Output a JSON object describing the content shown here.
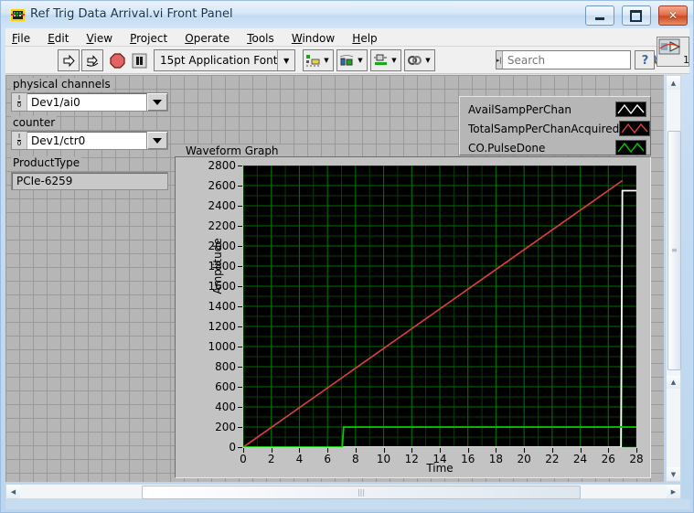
{
  "window": {
    "title": "Ref Trig Data Arrival.vi Front Panel",
    "icon_name": "labview-vi-icon",
    "minimize_label": "Minimize",
    "maximize_label": "Maximize",
    "close_label": "✕"
  },
  "menu": {
    "items": [
      {
        "label": "File",
        "mnemonic": "F"
      },
      {
        "label": "Edit",
        "mnemonic": "E"
      },
      {
        "label": "View",
        "mnemonic": "V"
      },
      {
        "label": "Project",
        "mnemonic": "P"
      },
      {
        "label": "Operate",
        "mnemonic": "O"
      },
      {
        "label": "Tools",
        "mnemonic": "T"
      },
      {
        "label": "Window",
        "mnemonic": "W"
      },
      {
        "label": "Help",
        "mnemonic": "H"
      }
    ]
  },
  "toolbar": {
    "run_icon": "run-arrow-icon",
    "run_continuous_icon": "run-continuously-icon",
    "abort_icon": "abort-execution-icon",
    "pause_icon": "pause-icon",
    "font_selector": "15pt Application Font",
    "font_dropdown_icon": "chevron-down-icon",
    "align_icon": "align-objects-icon",
    "distribute_icon": "distribute-objects-icon",
    "resize_icon": "resize-objects-icon",
    "reorder_icon": "reorder-objects-icon",
    "search_placeholder": "Search",
    "search_value": "",
    "search_icon": "magnifier-icon",
    "search_handle_icon": "drag-handle-icon",
    "help_icon": "question-mark-icon",
    "context_help_icon": "context-help-icon",
    "context_help_badge": "1"
  },
  "controls": {
    "physical_channels": {
      "label": "physical channels",
      "value": "Dev1/ai0",
      "glyph": "io-name-glyph",
      "dropdown_icon": "chevron-down-icon"
    },
    "counter": {
      "label": "counter",
      "value": "Dev1/ctr0",
      "glyph": "io-name-glyph",
      "dropdown_icon": "chevron-down-icon"
    },
    "product_type": {
      "label": "ProductType",
      "value": "PCIe-6259"
    }
  },
  "legend": {
    "plots": [
      {
        "name": "AvailSampPerChan",
        "color": "#ffffff"
      },
      {
        "name": "TotalSampPerChanAcquired",
        "color": "#e04040"
      },
      {
        "name": "CO.PulseDone",
        "color": "#00d000"
      }
    ]
  },
  "graph": {
    "title": "Waveform Graph"
  },
  "scrollbars": {
    "vertical_up_icon": "triangle-up-icon",
    "vertical_down_icon": "triangle-down-icon",
    "horizontal_left_icon": "triangle-left-icon",
    "horizontal_right_icon": "triangle-right-icon",
    "thumb_grip_icon": "grip-icon"
  },
  "chart_data": {
    "type": "line",
    "title": "Waveform Graph",
    "xlabel": "Time",
    "ylabel": "Amplitude",
    "xlim": [
      0,
      28
    ],
    "ylim": [
      0,
      2800
    ],
    "xticks": [
      0,
      2,
      4,
      6,
      8,
      10,
      12,
      14,
      16,
      18,
      20,
      22,
      24,
      26,
      28
    ],
    "yticks": [
      0,
      200,
      400,
      600,
      800,
      1000,
      1200,
      1400,
      1600,
      1800,
      2000,
      2200,
      2400,
      2600,
      2800
    ],
    "grid": true,
    "grid_color": "#007000",
    "background": "#000000",
    "legend_position": "top-right-external",
    "series": [
      {
        "name": "AvailSampPerChan",
        "color": "#ffffff",
        "x": [
          0,
          26.9,
          27.0,
          28
        ],
        "y": [
          0,
          0,
          2550,
          2550
        ],
        "note": "stays at 0 then steps up to ~2550 near t=27"
      },
      {
        "name": "TotalSampPerChanAcquired",
        "color": "#e04040",
        "x": [
          0,
          27
        ],
        "y": [
          0,
          2650
        ],
        "note": "linear ramp from origin to ~2650 at t=27"
      },
      {
        "name": "CO.PulseDone",
        "color": "#00d000",
        "x": [
          0,
          7.05,
          7.15,
          28
        ],
        "y": [
          0,
          0,
          200,
          200
        ],
        "note": "step from 0 to 200 at t≈7.1, then flat"
      }
    ]
  }
}
